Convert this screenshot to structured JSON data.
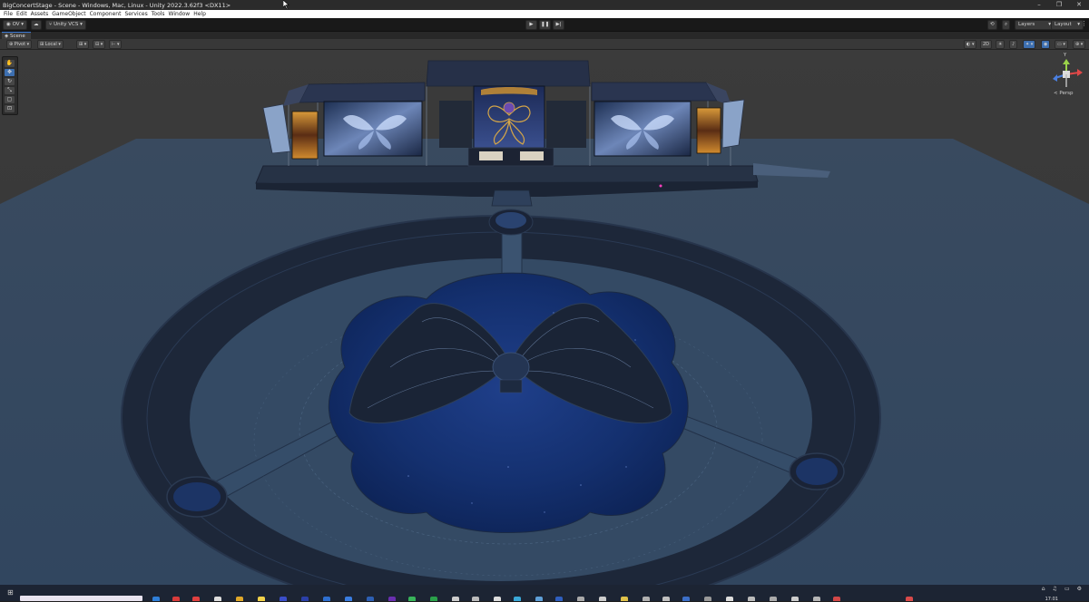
{
  "window": {
    "title": "BigConcertStage - Scene - Windows, Mac, Linux - Unity 2022.3.62f3 <DX11>",
    "controls": [
      "–",
      "❐",
      "✕"
    ]
  },
  "menu": {
    "items": [
      "File",
      "Edit",
      "Assets",
      "GameObject",
      "Component",
      "Services",
      "Tools",
      "Window",
      "Help"
    ]
  },
  "toolbar": {
    "account": "OV",
    "vcs": "Unity VCS",
    "layers": "Layers",
    "layout": "Layout"
  },
  "scene_tab": {
    "label": "Scene"
  },
  "scene_toolbar": {
    "pivot": "Pivot",
    "local": "Local",
    "mode_2d": "2D"
  },
  "gizmo": {
    "y_label": "Y",
    "projection": "< Persp"
  },
  "taskbar": {
    "clock": "17:01"
  },
  "colors": {
    "accent": "#3a79d6",
    "stage_floor": "#3c4d66",
    "ring": "#1f2a3d"
  }
}
